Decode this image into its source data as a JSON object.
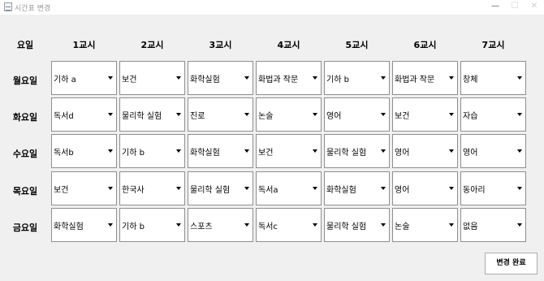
{
  "window": {
    "title": "시간표 변경",
    "minimize_glyph": "—",
    "maximize_glyph": "☐",
    "close_glyph": "✕"
  },
  "header": {
    "day_label": "요일",
    "periods": [
      "1교시",
      "2교시",
      "3교시",
      "4교시",
      "5교시",
      "6교시",
      "7교시"
    ]
  },
  "days": [
    {
      "label": "월요일",
      "slots": [
        "기하 a",
        "보건",
        "화학실험",
        "화법과 작문",
        "기하 b",
        "화법과 작문",
        "창체"
      ]
    },
    {
      "label": "화요일",
      "slots": [
        "독서d",
        "물리학 실험",
        "진로",
        "논술",
        "영어",
        "보건",
        "자습"
      ]
    },
    {
      "label": "수요일",
      "slots": [
        "독서b",
        "기하 b",
        "화학실험",
        "보건",
        "물리학 실험",
        "영어",
        "영어"
      ]
    },
    {
      "label": "목요일",
      "slots": [
        "보건",
        "한국사",
        "물리학 실험",
        "독서a",
        "화학실험",
        "영어",
        "동아리"
      ]
    },
    {
      "label": "금요일",
      "slots": [
        "화학실험",
        "기하 b",
        "스포츠",
        "독서c",
        "물리학 실험",
        "논술",
        "없음"
      ]
    }
  ],
  "actions": {
    "done_label": "변경 완료"
  }
}
